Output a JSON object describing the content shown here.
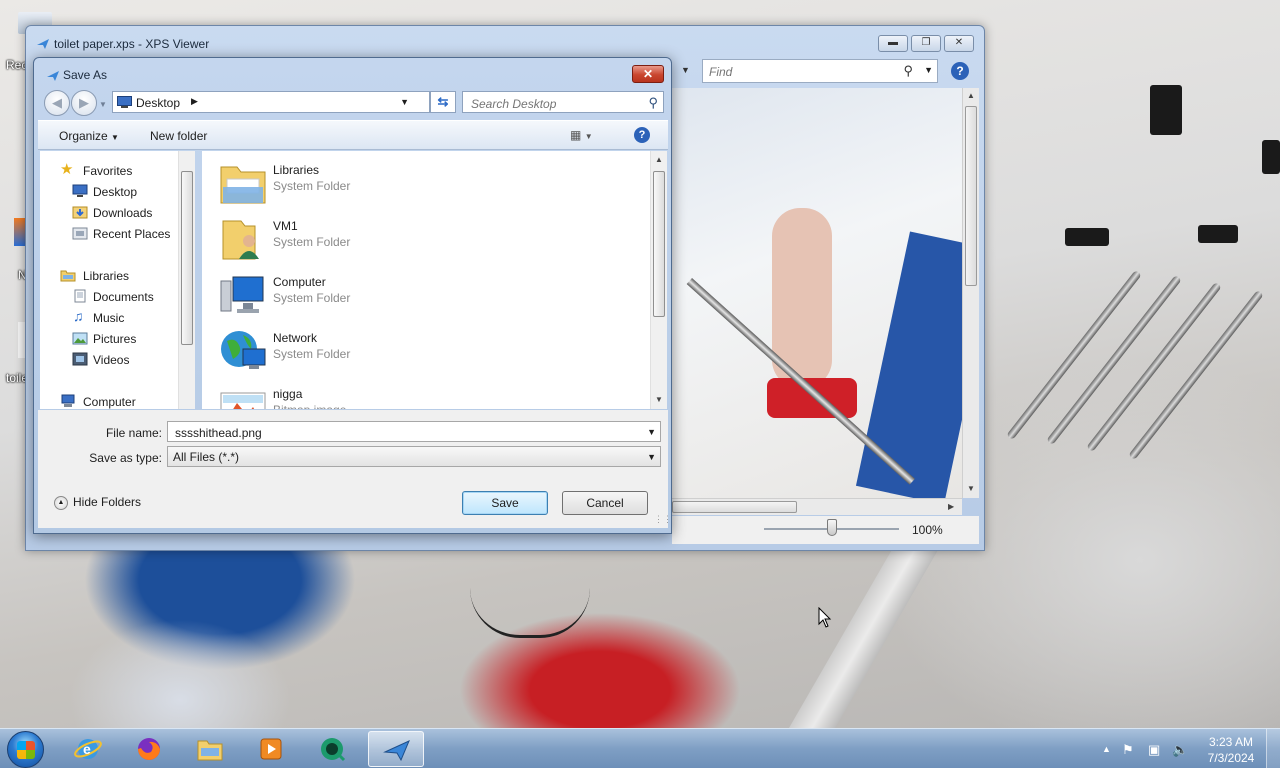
{
  "desktop": {
    "partial_labels": [
      "Rec",
      "N",
      "toile"
    ]
  },
  "xps_window": {
    "title": "toilet paper.xps - XPS Viewer",
    "find_placeholder": "Find",
    "zoom": "100%",
    "zoom_level": 0.5
  },
  "save_dialog": {
    "title": "Save As",
    "address": {
      "location": "Desktop"
    },
    "search_placeholder": "Search Desktop",
    "toolbar": {
      "organize": "Organize",
      "new_folder": "New folder"
    },
    "nav": {
      "favorites_header": "Favorites",
      "favorites": [
        "Desktop",
        "Downloads",
        "Recent Places"
      ],
      "libraries_header": "Libraries",
      "libraries": [
        "Documents",
        "Music",
        "Pictures",
        "Videos"
      ],
      "computer": "Computer"
    },
    "files": [
      {
        "name": "Libraries",
        "type": "System Folder",
        "icon": "libraries-folder-icon"
      },
      {
        "name": "VM1",
        "type": "System Folder",
        "icon": "user-folder-icon"
      },
      {
        "name": "Computer",
        "type": "System Folder",
        "icon": "computer-icon"
      },
      {
        "name": "Network",
        "type": "System Folder",
        "icon": "network-icon"
      },
      {
        "name": "nigga",
        "type": "Bitmap image",
        "icon": "bitmap-image-icon"
      }
    ],
    "file_name_label": "File name:",
    "file_name_value": "sssshithead.png",
    "save_type_label": "Save as type:",
    "save_type_value": "All Files (*.*)",
    "hide_folders": "Hide Folders",
    "save_button": "Save",
    "cancel_button": "Cancel"
  },
  "taskbar": {
    "apps": [
      "internet-explorer-icon",
      "firefox-icon",
      "file-explorer-icon",
      "media-player-icon",
      "green-app-icon",
      "xps-viewer-icon"
    ],
    "time": "3:23 AM",
    "date": "7/3/2024"
  }
}
